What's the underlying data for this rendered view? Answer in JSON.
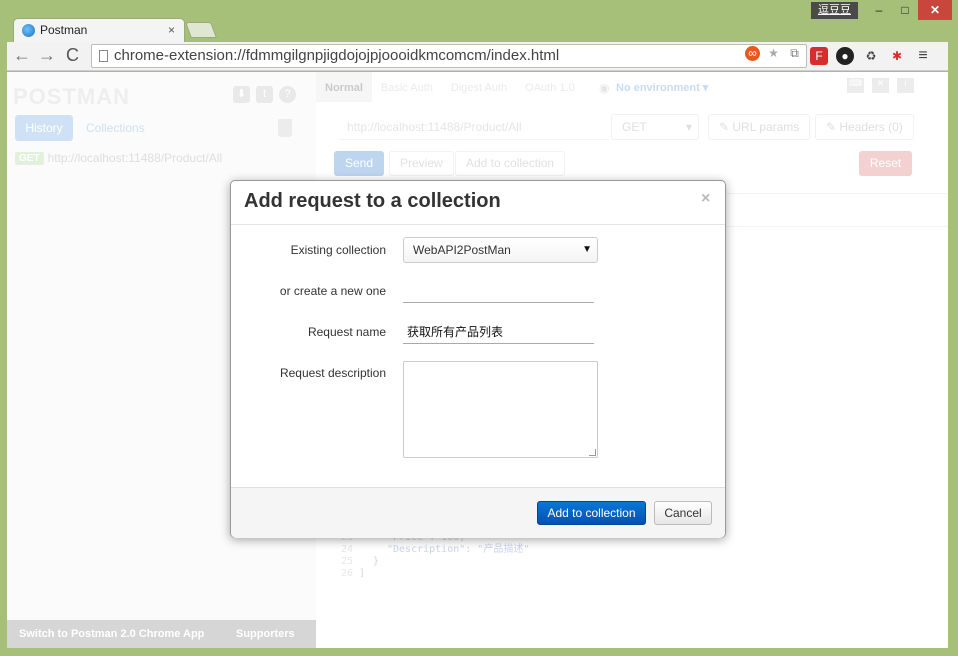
{
  "browser": {
    "user_badge": "逗豆豆",
    "tab_title": "Postman",
    "url": "chrome-extension://fdmmgilgnpjigdojojpjoooidkmcomcm/index.html",
    "window_controls": {
      "minimize": "–",
      "maximize": "□",
      "close": "✕"
    },
    "tab_close": "×",
    "nav": {
      "back": "←",
      "forward": "→",
      "reload": "C"
    }
  },
  "sidebar": {
    "logo": "POSTMAN",
    "tabs": {
      "history": "History",
      "collections": "Collections"
    },
    "history_items": [
      {
        "method": "GET",
        "url": "http://localhost:11488/Product/All"
      }
    ],
    "footer": {
      "switch": "Switch to Postman 2.0 Chrome App",
      "supporters": "Supporters"
    }
  },
  "main": {
    "auth_tabs": [
      "Normal",
      "Basic Auth",
      "Digest Auth",
      "OAuth 1.0"
    ],
    "environment": "No environment ▾",
    "request_url": "http://localhost:11488/Product/All",
    "method": "GET",
    "url_params": "URL params",
    "headers": "Headers (0)",
    "send": "Send",
    "preview": "Preview",
    "add_to_collection": "Add to collection",
    "reset": "Reset",
    "code_lines": [
      {
        "num": "23",
        "text": "\"Price\": 100,"
      },
      {
        "num": "24",
        "text": "\"Description\": \"产品描述\""
      },
      {
        "num": "25",
        "text": "}"
      },
      {
        "num": "26",
        "text": "]"
      }
    ]
  },
  "modal": {
    "title": "Add request to a collection",
    "close": "×",
    "existing_collection_label": "Existing collection",
    "existing_collection_value": "WebAPI2PostMan",
    "new_collection_label": "or create a new one",
    "new_collection_value": "",
    "request_name_label": "Request name",
    "request_name_value": "获取所有产品列表",
    "request_description_label": "Request description",
    "request_description_value": "",
    "submit": "Add to collection",
    "cancel": "Cancel"
  }
}
